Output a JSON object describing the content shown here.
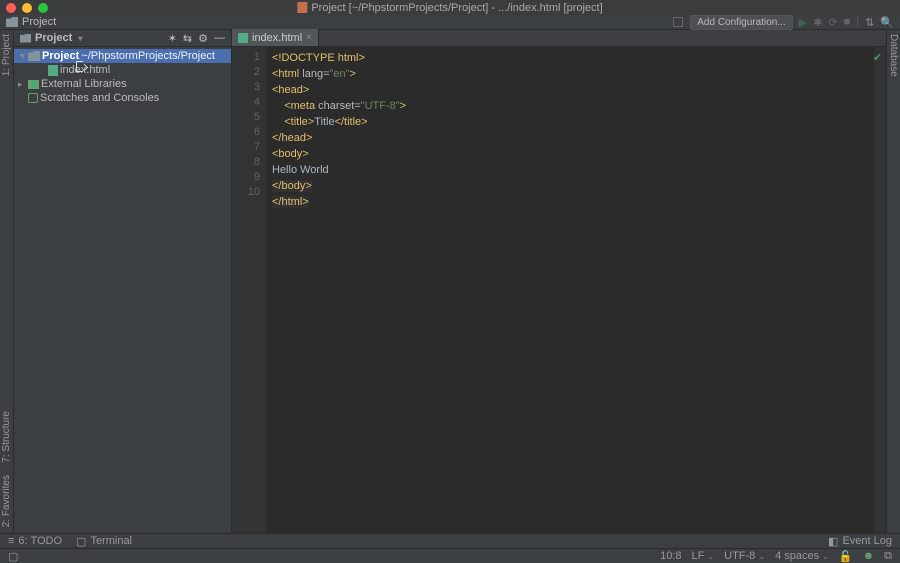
{
  "titlebar": {
    "text": "Project [~/PhpstormProjects/Project] - .../index.html [project]"
  },
  "breadcrumb": {
    "project": "Project",
    "add_config": "Add Configuration..."
  },
  "sidebar": {
    "title": "Project",
    "rows": [
      {
        "name": "Project",
        "path": "~/PhpstormProjects/Project"
      },
      {
        "name": "index.html"
      },
      {
        "name": "External Libraries"
      },
      {
        "name": "Scratches and Consoles"
      }
    ]
  },
  "left_gutter": {
    "project": "1: Project",
    "structure": "7: Structure",
    "favorites": "2: Favorites"
  },
  "right_gutter": {
    "database": "Database"
  },
  "tab": {
    "filename": "index.html"
  },
  "code": {
    "l1": "<!DOCTYPE html>",
    "l2a": "<html ",
    "l2b": "lang=",
    "l2c": "\"en\"",
    "l2d": ">",
    "l3": "<head>",
    "l4a": "    <meta ",
    "l4b": "charset=",
    "l4c": "\"UTF-8\"",
    "l4d": ">",
    "l5a": "    <title>",
    "l5b": "Title",
    "l5c": "</title>",
    "l6": "</head>",
    "l7": "<body>",
    "l8": "Hello World",
    "l9": "</body>",
    "l10": "</html>"
  },
  "lines": [
    "1",
    "2",
    "3",
    "4",
    "5",
    "6",
    "7",
    "8",
    "9",
    "10"
  ],
  "bottom": {
    "todo": "6: TODO",
    "terminal": "Terminal",
    "eventlog": "Event Log"
  },
  "status": {
    "pos": "10:8",
    "le": "LF",
    "enc": "UTF-8",
    "indent": "4 spaces"
  }
}
